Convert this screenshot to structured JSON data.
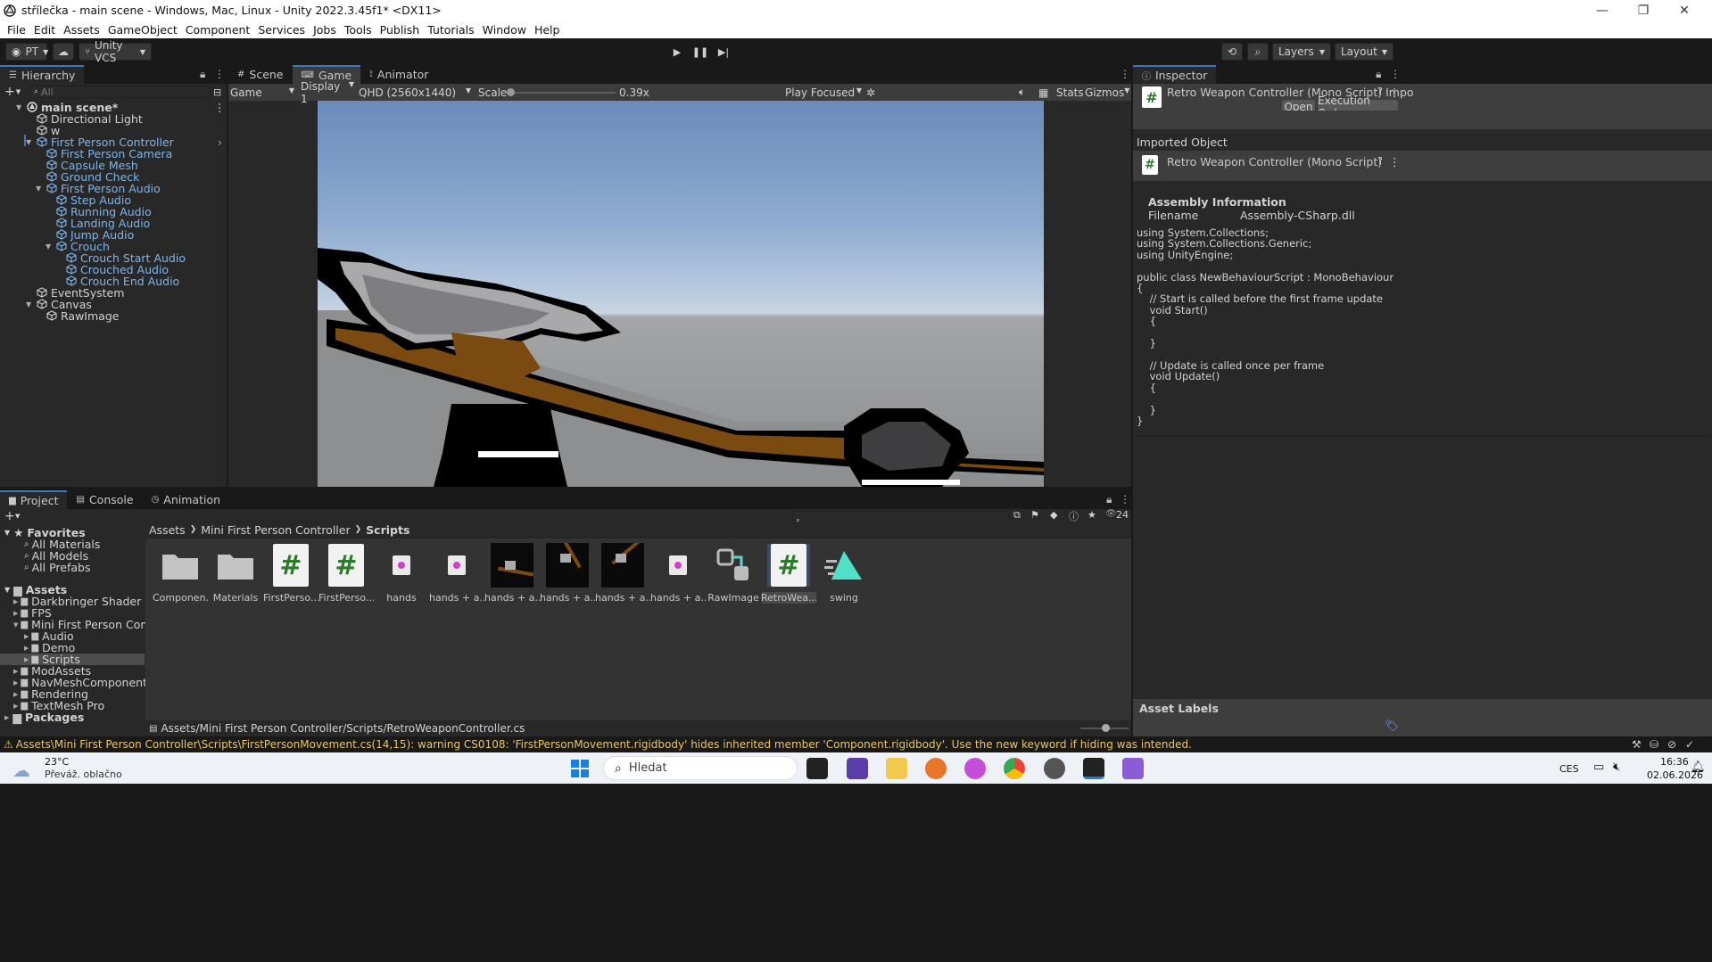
{
  "window": {
    "title": "střílečka - main scene - Windows, Mac, Linux - Unity 2022.3.45f1* <DX11>"
  },
  "menu": [
    "File",
    "Edit",
    "Assets",
    "GameObject",
    "Component",
    "Services",
    "Jobs",
    "Tools",
    "Publish",
    "Tutorials",
    "Window",
    "Help"
  ],
  "toolbar": {
    "account": "PT",
    "vcs": "Unity VCS",
    "layers": "Layers",
    "layout": "Layout"
  },
  "hierarchy": {
    "tab": "Hierarchy",
    "search_placeholder": "All",
    "items": [
      {
        "label": "main scene*",
        "depth": 0,
        "kind": "scene"
      },
      {
        "label": "Directional Light",
        "depth": 1
      },
      {
        "label": "w",
        "depth": 1
      },
      {
        "label": "First Person Controller",
        "depth": 1,
        "blue": true,
        "expanded": true
      },
      {
        "label": "First Person Camera",
        "depth": 2,
        "blue": true
      },
      {
        "label": "Capsule Mesh",
        "depth": 2,
        "blue": true
      },
      {
        "label": "Ground Check",
        "depth": 2,
        "blue": true
      },
      {
        "label": "First Person Audio",
        "depth": 2,
        "blue": true,
        "expanded": true
      },
      {
        "label": "Step Audio",
        "depth": 3,
        "blue": true
      },
      {
        "label": "Running Audio",
        "depth": 3,
        "blue": true
      },
      {
        "label": "Landing Audio",
        "depth": 3,
        "blue": true
      },
      {
        "label": "Jump Audio",
        "depth": 3,
        "blue": true
      },
      {
        "label": "Crouch",
        "depth": 3,
        "blue": true,
        "expanded": true
      },
      {
        "label": "Crouch Start Audio",
        "depth": 4,
        "blue": true
      },
      {
        "label": "Crouched Audio",
        "depth": 4,
        "blue": true
      },
      {
        "label": "Crouch End Audio",
        "depth": 4,
        "blue": true
      },
      {
        "label": "EventSystem",
        "depth": 1
      },
      {
        "label": "Canvas",
        "depth": 1,
        "expanded": true
      },
      {
        "label": "RawImage",
        "depth": 2
      }
    ]
  },
  "gameview": {
    "tabs": [
      "Scene",
      "Game",
      "Animator"
    ],
    "mode": "Game",
    "display": "Display 1",
    "resolution": "QHD (2560x1440)",
    "scale_label": "Scale",
    "scale_value": "0.39x",
    "play_focused": "Play Focused",
    "stats": "Stats",
    "gizmos": "Gizmos"
  },
  "inspector": {
    "tab": "Inspector",
    "title": "Retro Weapon Controller (Mono Script) Impo",
    "open_btn": "Open",
    "exec_btn": "Execution Order...",
    "imported_object": "Imported Object",
    "subtitle": "Retro Weapon Controller (Mono Script)",
    "assembly_info": "Assembly Information",
    "filename_label": "Filename",
    "filename_value": "Assembly-CSharp.dll",
    "code": "using System.Collections;\nusing System.Collections.Generic;\nusing UnityEngine;\n\npublic class NewBehaviourScript : MonoBehaviour\n{\n    // Start is called before the first frame update\n    void Start()\n    {\n\n    }\n\n    // Update is called once per frame\n    void Update()\n    {\n\n    }\n}",
    "asset_labels": "Asset Labels"
  },
  "project": {
    "tabs": [
      "Project",
      "Console",
      "Animation"
    ],
    "count": "24",
    "favorites": "Favorites",
    "fav_items": [
      "All Materials",
      "All Models",
      "All Prefabs"
    ],
    "assets_root": "Assets",
    "tree": [
      {
        "label": "Darkbringer Shader",
        "depth": 1
      },
      {
        "label": "FPS",
        "depth": 1
      },
      {
        "label": "Mini First Person Controller",
        "depth": 1,
        "expanded": true
      },
      {
        "label": "Audio",
        "depth": 2
      },
      {
        "label": "Demo",
        "depth": 2
      },
      {
        "label": "Scripts",
        "depth": 2,
        "selected": true
      },
      {
        "label": "ModAssets",
        "depth": 1
      },
      {
        "label": "NavMeshComponents",
        "depth": 1
      },
      {
        "label": "Rendering",
        "depth": 1
      },
      {
        "label": "TextMesh Pro",
        "depth": 1
      }
    ],
    "packages": "Packages",
    "breadcrumb": [
      "Assets",
      "Mini First Person Controller",
      "Scripts"
    ],
    "assets": [
      {
        "label": "Componen...",
        "type": "folder"
      },
      {
        "label": "Materials",
        "type": "folder"
      },
      {
        "label": "FirstPerso...",
        "type": "script"
      },
      {
        "label": "FirstPerso...",
        "type": "script"
      },
      {
        "label": "hands",
        "type": "sprite"
      },
      {
        "label": "hands + a...",
        "type": "sprite"
      },
      {
        "label": "hands + a...",
        "type": "image1"
      },
      {
        "label": "hands + a...",
        "type": "image2"
      },
      {
        "label": "hands + a...",
        "type": "image3"
      },
      {
        "label": "hands + a...",
        "type": "sprite"
      },
      {
        "label": "RawImage",
        "type": "rawimage"
      },
      {
        "label": "RetroWea...",
        "type": "script",
        "selected": true
      },
      {
        "label": "swing",
        "type": "anim"
      }
    ],
    "path": "Assets/Mini First Person Controller/Scripts/RetroWeaponController.cs"
  },
  "status": {
    "warning": "Assets\\Mini First Person Controller\\Scripts\\FirstPersonMovement.cs(14,15): warning CS0108: 'FirstPersonMovement.rigidbody' hides inherited member 'Component.rigidbody'. Use the new keyword if hiding was intended."
  },
  "taskbar": {
    "weather_temp": "23°C",
    "weather_desc": "Převáž. oblačno",
    "search": "Hledat",
    "lang": "CES",
    "time": "16:36",
    "date": "02.06.2026"
  }
}
